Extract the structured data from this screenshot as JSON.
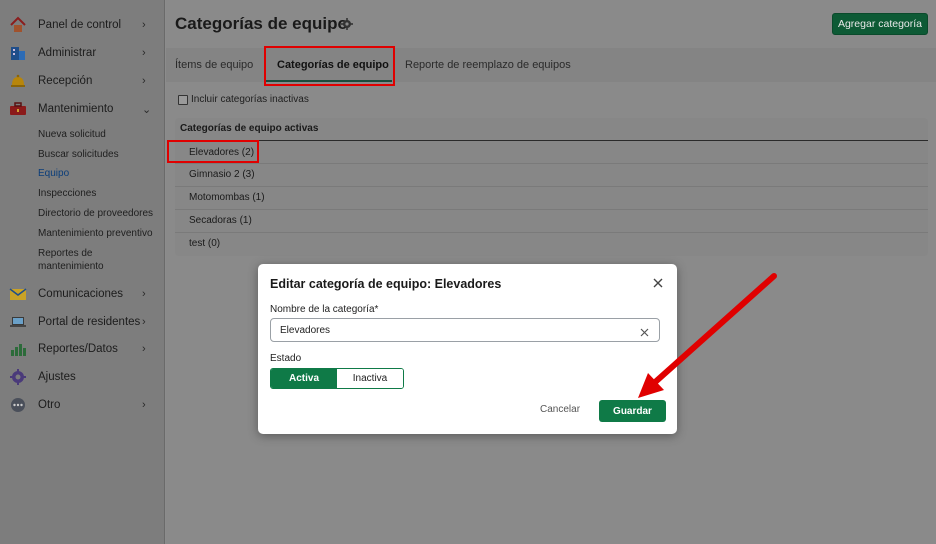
{
  "sidebar": {
    "items": [
      {
        "label": "Panel de control",
        "icon": "home-icon",
        "chev": "›"
      },
      {
        "label": "Administrar",
        "icon": "building-icon",
        "chev": "›"
      },
      {
        "label": "Recepción",
        "icon": "bell-icon",
        "chev": "›"
      },
      {
        "label": "Mantenimiento",
        "icon": "toolbox-icon",
        "chev": "⌄"
      },
      {
        "label": "Comunicaciones",
        "icon": "envelope-icon",
        "chev": "›"
      },
      {
        "label": "Portal de residentes",
        "icon": "laptop-icon",
        "chev": "›"
      },
      {
        "label": "Reportes/Datos",
        "icon": "chart-icon",
        "chev": "›"
      },
      {
        "label": "Ajustes",
        "icon": "gear-icon",
        "chev": ""
      },
      {
        "label": "Otro",
        "icon": "more-icon",
        "chev": "›"
      }
    ],
    "subitems": [
      "Nueva solicitud",
      "Buscar solicitudes",
      "Equipo",
      "Inspecciones",
      "Directorio de proveedores",
      "Mantenimiento preventivo",
      "Reportes de mantenimiento"
    ]
  },
  "header": {
    "title": "Categorías de equipo",
    "add_button": "Agregar categoría"
  },
  "tabs": [
    "Ítems de equipo",
    "Categorías de equipo",
    "Reporte de reemplazo de equipos"
  ],
  "filter": {
    "include_inactive": "Incluir categorías inactivas"
  },
  "table": {
    "heading": "Categorías de equipo activas",
    "rows": [
      "Elevadores (2)",
      "Gimnasio 2 (3)",
      "Motomombas (1)",
      "Secadoras (1)",
      "test (0)"
    ]
  },
  "modal": {
    "title": "Editar categoría de equipo: Elevadores",
    "name_label": "Nombre de la categoría*",
    "name_value": "Elevadores",
    "status_label": "Estado",
    "status_active": "Activa",
    "status_inactive": "Inactiva",
    "cancel": "Cancelar",
    "save": "Guardar"
  },
  "colors": {
    "accent": "#0f7a47",
    "annotation": "#e00000"
  }
}
